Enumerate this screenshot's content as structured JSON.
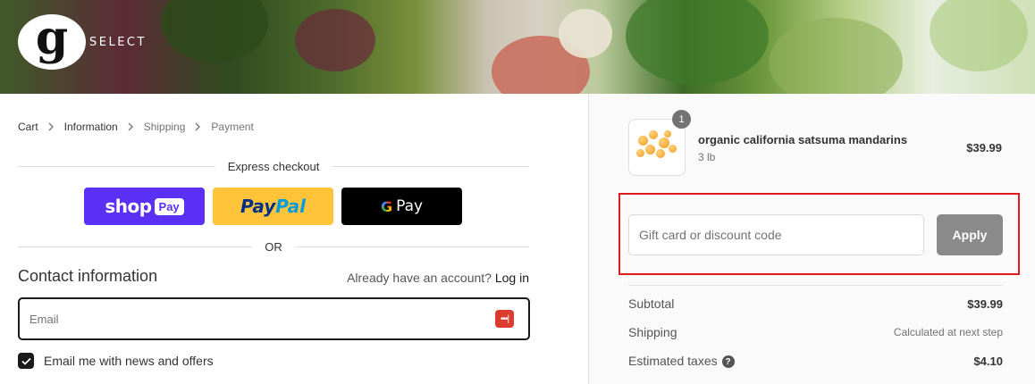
{
  "brand": {
    "logo_letter": "g",
    "logo_text": "SELECT"
  },
  "breadcrumb": [
    {
      "label": "Cart"
    },
    {
      "label": "Information"
    },
    {
      "label": "Shipping"
    },
    {
      "label": "Payment"
    }
  ],
  "express": {
    "label": "Express checkout",
    "shop_pay": {
      "word": "shop",
      "pill": "Pay"
    },
    "paypal": {
      "part1": "Pay",
      "part2": "Pal"
    },
    "gpay": {
      "g": "G",
      "word": "Pay"
    },
    "or_label": "OR"
  },
  "contact": {
    "title": "Contact information",
    "account_prompt": "Already have an account?",
    "login_label": "Log in",
    "email_placeholder": "Email",
    "email_value": "",
    "newsletter_label": "Email me with news and offers",
    "newsletter_checked": true
  },
  "order": {
    "product": {
      "name": "organic california satsuma mandarins",
      "variant": "3 lb",
      "price": "$39.99",
      "quantity": "1"
    },
    "discount": {
      "placeholder": "Gift card or discount code",
      "apply_label": "Apply",
      "highlight_color": "#e01b1b"
    },
    "summary": {
      "subtotal_label": "Subtotal",
      "subtotal_value": "$39.99",
      "shipping_label": "Shipping",
      "shipping_value": "Calculated at next step",
      "taxes_label": "Estimated taxes",
      "taxes_value": "$4.10"
    }
  },
  "colors": {
    "shop_pay": "#5a31f4",
    "paypal": "#ffc439",
    "gpay": "#000000",
    "apply_button": "#8a8a8a"
  }
}
